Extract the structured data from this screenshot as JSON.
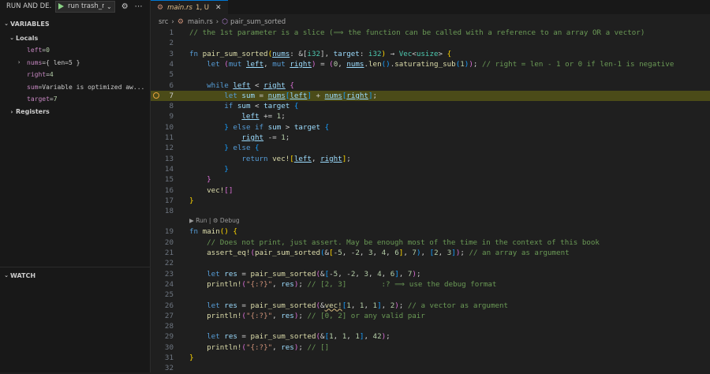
{
  "debug": {
    "title": "RUN AND DE...",
    "config": "run trash_r",
    "sections": {
      "variables": "VARIABLES",
      "locals": "Locals",
      "registers": "Registers",
      "watch": "WATCH"
    },
    "vars": [
      {
        "name": "left",
        "value": "0"
      },
      {
        "name": "nums",
        "value": "{ len=5 }"
      },
      {
        "name": "right",
        "value": "4"
      },
      {
        "name": "sum",
        "value": "Variable is optimized aw..."
      },
      {
        "name": "target",
        "value": "7"
      }
    ]
  },
  "tab": {
    "name": "main.rs",
    "status": "1, U"
  },
  "breadcrumb": {
    "folder": "src",
    "file": "main.rs",
    "symbol": "pair_sum_sorted"
  },
  "codelens": "▶ Run | ⚙ Debug",
  "current_line": 7,
  "lines": [
    {
      "n": "1",
      "segs": [
        {
          "c": "c",
          "t": "// the 1st parameter is a slice (⟹ the function can be called with a reference to an array OR a vector)"
        }
      ]
    },
    {
      "n": "2",
      "segs": []
    },
    {
      "n": "3",
      "segs": [
        {
          "c": "k",
          "t": "fn "
        },
        {
          "c": "f",
          "t": "pair_sum_sorted"
        },
        {
          "c": "y",
          "t": "("
        },
        {
          "c": "v ul",
          "t": "nums"
        },
        {
          "c": "",
          "t": ": &["
        },
        {
          "c": "t",
          "t": "i32"
        },
        {
          "c": "",
          "t": "], "
        },
        {
          "c": "v",
          "t": "target"
        },
        {
          "c": "",
          "t": ": "
        },
        {
          "c": "t",
          "t": "i32"
        },
        {
          "c": "y",
          "t": ")"
        },
        {
          "c": "",
          "t": " → "
        },
        {
          "c": "t",
          "t": "Vec"
        },
        {
          "c": "",
          "t": "<"
        },
        {
          "c": "t",
          "t": "usize"
        },
        {
          "c": "",
          "t": "> "
        },
        {
          "c": "y",
          "t": "{"
        }
      ]
    },
    {
      "n": "4",
      "segs": [
        {
          "c": "",
          "t": "    "
        },
        {
          "c": "k",
          "t": "let "
        },
        {
          "c": "p",
          "t": "("
        },
        {
          "c": "k",
          "t": "mut "
        },
        {
          "c": "v ul",
          "t": "left"
        },
        {
          "c": "",
          "t": ", "
        },
        {
          "c": "k",
          "t": "mut "
        },
        {
          "c": "v ul",
          "t": "right"
        },
        {
          "c": "p",
          "t": ")"
        },
        {
          "c": "",
          "t": " = "
        },
        {
          "c": "p",
          "t": "("
        },
        {
          "c": "n",
          "t": "0"
        },
        {
          "c": "",
          "t": ", "
        },
        {
          "c": "v ul",
          "t": "nums"
        },
        {
          "c": "",
          "t": "."
        },
        {
          "c": "f",
          "t": "len"
        },
        {
          "c": "b",
          "t": "()"
        },
        {
          "c": "",
          "t": "."
        },
        {
          "c": "f",
          "t": "saturating_sub"
        },
        {
          "c": "b",
          "t": "("
        },
        {
          "c": "n",
          "t": "1"
        },
        {
          "c": "b",
          "t": ")"
        },
        {
          "c": "p",
          "t": ")"
        },
        {
          "c": "",
          "t": "; "
        },
        {
          "c": "c",
          "t": "// right = len - 1 or 0 if len-1 is negative"
        }
      ]
    },
    {
      "n": "5",
      "segs": []
    },
    {
      "n": "6",
      "segs": [
        {
          "c": "",
          "t": "    "
        },
        {
          "c": "k",
          "t": "while "
        },
        {
          "c": "v ul",
          "t": "left"
        },
        {
          "c": "",
          "t": " < "
        },
        {
          "c": "v ul",
          "t": "right"
        },
        {
          "c": "",
          "t": " "
        },
        {
          "c": "p",
          "t": "{"
        }
      ]
    },
    {
      "n": "7",
      "segs": [
        {
          "c": "",
          "t": "        "
        },
        {
          "c": "k",
          "t": "let "
        },
        {
          "c": "v",
          "t": "sum"
        },
        {
          "c": "",
          "t": " = "
        },
        {
          "c": "v ul",
          "t": "nums"
        },
        {
          "c": "b",
          "t": "["
        },
        {
          "c": "v ul",
          "t": "left"
        },
        {
          "c": "b",
          "t": "]"
        },
        {
          "c": "",
          "t": " + "
        },
        {
          "c": "v ul",
          "t": "nums"
        },
        {
          "c": "b",
          "t": "["
        },
        {
          "c": "v ul",
          "t": "right"
        },
        {
          "c": "b",
          "t": "]"
        },
        {
          "c": "",
          "t": ";"
        }
      ]
    },
    {
      "n": "8",
      "segs": [
        {
          "c": "",
          "t": "        "
        },
        {
          "c": "k",
          "t": "if "
        },
        {
          "c": "v",
          "t": "sum"
        },
        {
          "c": "",
          "t": " < "
        },
        {
          "c": "v",
          "t": "target"
        },
        {
          "c": "",
          "t": " "
        },
        {
          "c": "b",
          "t": "{"
        }
      ]
    },
    {
      "n": "9",
      "segs": [
        {
          "c": "",
          "t": "            "
        },
        {
          "c": "v ul",
          "t": "left"
        },
        {
          "c": "",
          "t": " += "
        },
        {
          "c": "n",
          "t": "1"
        },
        {
          "c": "",
          "t": ";"
        }
      ]
    },
    {
      "n": "10",
      "segs": [
        {
          "c": "",
          "t": "        "
        },
        {
          "c": "b",
          "t": "}"
        },
        {
          "c": "",
          "t": " "
        },
        {
          "c": "k",
          "t": "else if "
        },
        {
          "c": "v",
          "t": "sum"
        },
        {
          "c": "",
          "t": " > "
        },
        {
          "c": "v",
          "t": "target"
        },
        {
          "c": "",
          "t": " "
        },
        {
          "c": "b",
          "t": "{"
        }
      ]
    },
    {
      "n": "11",
      "segs": [
        {
          "c": "",
          "t": "            "
        },
        {
          "c": "v ul",
          "t": "right"
        },
        {
          "c": "",
          "t": " -= "
        },
        {
          "c": "n",
          "t": "1"
        },
        {
          "c": "",
          "t": ";"
        }
      ]
    },
    {
      "n": "12",
      "segs": [
        {
          "c": "",
          "t": "        "
        },
        {
          "c": "b",
          "t": "}"
        },
        {
          "c": "",
          "t": " "
        },
        {
          "c": "k",
          "t": "else "
        },
        {
          "c": "b",
          "t": "{"
        }
      ]
    },
    {
      "n": "13",
      "segs": [
        {
          "c": "",
          "t": "            "
        },
        {
          "c": "k",
          "t": "return "
        },
        {
          "c": "f",
          "t": "vec!"
        },
        {
          "c": "y",
          "t": "["
        },
        {
          "c": "v ul",
          "t": "left"
        },
        {
          "c": "",
          "t": ", "
        },
        {
          "c": "v ul",
          "t": "right"
        },
        {
          "c": "y",
          "t": "]"
        },
        {
          "c": "",
          "t": ";"
        }
      ]
    },
    {
      "n": "14",
      "segs": [
        {
          "c": "",
          "t": "        "
        },
        {
          "c": "b",
          "t": "}"
        }
      ]
    },
    {
      "n": "15",
      "segs": [
        {
          "c": "",
          "t": "    "
        },
        {
          "c": "p",
          "t": "}"
        }
      ]
    },
    {
      "n": "16",
      "segs": [
        {
          "c": "",
          "t": "    "
        },
        {
          "c": "f",
          "t": "vec!"
        },
        {
          "c": "p",
          "t": "[]"
        }
      ]
    },
    {
      "n": "17",
      "segs": [
        {
          "c": "y",
          "t": "}"
        }
      ]
    },
    {
      "n": "18",
      "segs": []
    },
    {
      "n": "19",
      "segs": [
        {
          "c": "k",
          "t": "fn "
        },
        {
          "c": "f",
          "t": "main"
        },
        {
          "c": "y",
          "t": "()"
        },
        {
          "c": "",
          "t": " "
        },
        {
          "c": "y",
          "t": "{"
        }
      ]
    },
    {
      "n": "20",
      "segs": [
        {
          "c": "",
          "t": "    "
        },
        {
          "c": "c",
          "t": "// Does not print, just assert. May be enough most of the time in the context of this book"
        }
      ]
    },
    {
      "n": "21",
      "segs": [
        {
          "c": "",
          "t": "    "
        },
        {
          "c": "f",
          "t": "assert_eq!"
        },
        {
          "c": "p",
          "t": "("
        },
        {
          "c": "f",
          "t": "pair_sum_sorted"
        },
        {
          "c": "b",
          "t": "("
        },
        {
          "c": "",
          "t": "&"
        },
        {
          "c": "y",
          "t": "["
        },
        {
          "c": "",
          "t": "-"
        },
        {
          "c": "n",
          "t": "5"
        },
        {
          "c": "",
          "t": ", -"
        },
        {
          "c": "n",
          "t": "2"
        },
        {
          "c": "",
          "t": ", "
        },
        {
          "c": "n",
          "t": "3"
        },
        {
          "c": "",
          "t": ", "
        },
        {
          "c": "n",
          "t": "4"
        },
        {
          "c": "",
          "t": ", "
        },
        {
          "c": "n",
          "t": "6"
        },
        {
          "c": "y",
          "t": "]"
        },
        {
          "c": "",
          "t": ", "
        },
        {
          "c": "n",
          "t": "7"
        },
        {
          "c": "b",
          "t": ")"
        },
        {
          "c": "",
          "t": ", "
        },
        {
          "c": "b",
          "t": "["
        },
        {
          "c": "n",
          "t": "2"
        },
        {
          "c": "",
          "t": ", "
        },
        {
          "c": "n",
          "t": "3"
        },
        {
          "c": "b",
          "t": "]"
        },
        {
          "c": "p",
          "t": ")"
        },
        {
          "c": "",
          "t": "; "
        },
        {
          "c": "c",
          "t": "// an array as argument"
        }
      ]
    },
    {
      "n": "22",
      "segs": []
    },
    {
      "n": "23",
      "segs": [
        {
          "c": "",
          "t": "    "
        },
        {
          "c": "k",
          "t": "let "
        },
        {
          "c": "v",
          "t": "res"
        },
        {
          "c": "",
          "t": " = "
        },
        {
          "c": "f",
          "t": "pair_sum_sorted"
        },
        {
          "c": "p",
          "t": "("
        },
        {
          "c": "",
          "t": "&"
        },
        {
          "c": "b",
          "t": "["
        },
        {
          "c": "",
          "t": "-"
        },
        {
          "c": "n",
          "t": "5"
        },
        {
          "c": "",
          "t": ", -"
        },
        {
          "c": "n",
          "t": "2"
        },
        {
          "c": "",
          "t": ", "
        },
        {
          "c": "n",
          "t": "3"
        },
        {
          "c": "",
          "t": ", "
        },
        {
          "c": "n",
          "t": "4"
        },
        {
          "c": "",
          "t": ", "
        },
        {
          "c": "n",
          "t": "6"
        },
        {
          "c": "b",
          "t": "]"
        },
        {
          "c": "",
          "t": ", "
        },
        {
          "c": "n",
          "t": "7"
        },
        {
          "c": "p",
          "t": ")"
        },
        {
          "c": "",
          "t": ";"
        }
      ]
    },
    {
      "n": "24",
      "segs": [
        {
          "c": "",
          "t": "    "
        },
        {
          "c": "f",
          "t": "println!"
        },
        {
          "c": "p",
          "t": "("
        },
        {
          "c": "s",
          "t": "\"{:?}\""
        },
        {
          "c": "",
          "t": ", "
        },
        {
          "c": "v",
          "t": "res"
        },
        {
          "c": "p",
          "t": ")"
        },
        {
          "c": "",
          "t": "; "
        },
        {
          "c": "c",
          "t": "// [2, 3]        :? ⟹ use the debug format"
        }
      ]
    },
    {
      "n": "25",
      "segs": []
    },
    {
      "n": "26",
      "segs": [
        {
          "c": "",
          "t": "    "
        },
        {
          "c": "k",
          "t": "let "
        },
        {
          "c": "v",
          "t": "res"
        },
        {
          "c": "",
          "t": " = "
        },
        {
          "c": "f",
          "t": "pair_sum_sorted"
        },
        {
          "c": "p",
          "t": "("
        },
        {
          "c": "",
          "t": "&"
        },
        {
          "c": "f sq",
          "t": "vec!"
        },
        {
          "c": "b",
          "t": "["
        },
        {
          "c": "n",
          "t": "1"
        },
        {
          "c": "",
          "t": ", "
        },
        {
          "c": "n",
          "t": "1"
        },
        {
          "c": "",
          "t": ", "
        },
        {
          "c": "n",
          "t": "1"
        },
        {
          "c": "b",
          "t": "]"
        },
        {
          "c": "",
          "t": ", "
        },
        {
          "c": "n",
          "t": "2"
        },
        {
          "c": "p",
          "t": ")"
        },
        {
          "c": "",
          "t": "; "
        },
        {
          "c": "c",
          "t": "// a vector as argument"
        }
      ]
    },
    {
      "n": "27",
      "segs": [
        {
          "c": "",
          "t": "    "
        },
        {
          "c": "f",
          "t": "println!"
        },
        {
          "c": "p",
          "t": "("
        },
        {
          "c": "s",
          "t": "\"{:?}\""
        },
        {
          "c": "",
          "t": ", "
        },
        {
          "c": "v",
          "t": "res"
        },
        {
          "c": "p",
          "t": ")"
        },
        {
          "c": "",
          "t": "; "
        },
        {
          "c": "c",
          "t": "// [0, 2] or any valid pair"
        }
      ]
    },
    {
      "n": "28",
      "segs": []
    },
    {
      "n": "29",
      "segs": [
        {
          "c": "",
          "t": "    "
        },
        {
          "c": "k",
          "t": "let "
        },
        {
          "c": "v",
          "t": "res"
        },
        {
          "c": "",
          "t": " = "
        },
        {
          "c": "f",
          "t": "pair_sum_sorted"
        },
        {
          "c": "p",
          "t": "("
        },
        {
          "c": "",
          "t": "&"
        },
        {
          "c": "b",
          "t": "["
        },
        {
          "c": "n",
          "t": "1"
        },
        {
          "c": "",
          "t": ", "
        },
        {
          "c": "n",
          "t": "1"
        },
        {
          "c": "",
          "t": ", "
        },
        {
          "c": "n",
          "t": "1"
        },
        {
          "c": "b",
          "t": "]"
        },
        {
          "c": "",
          "t": ", "
        },
        {
          "c": "n",
          "t": "42"
        },
        {
          "c": "p",
          "t": ")"
        },
        {
          "c": "",
          "t": ";"
        }
      ]
    },
    {
      "n": "30",
      "segs": [
        {
          "c": "",
          "t": "    "
        },
        {
          "c": "f",
          "t": "println!"
        },
        {
          "c": "p",
          "t": "("
        },
        {
          "c": "s",
          "t": "\"{:?}\""
        },
        {
          "c": "",
          "t": ", "
        },
        {
          "c": "v",
          "t": "res"
        },
        {
          "c": "p",
          "t": ")"
        },
        {
          "c": "",
          "t": "; "
        },
        {
          "c": "c",
          "t": "// []"
        }
      ]
    },
    {
      "n": "31",
      "segs": [
        {
          "c": "y",
          "t": "}"
        }
      ]
    },
    {
      "n": "32",
      "segs": []
    }
  ]
}
